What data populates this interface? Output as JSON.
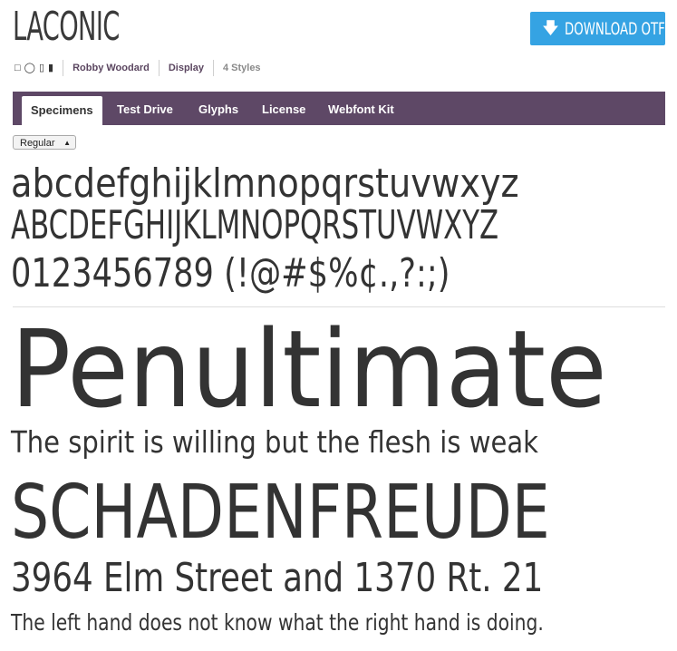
{
  "header": {
    "font_title": "LACONIC",
    "download_label": "DOWNLOAD OTF",
    "download_icon": "arrow-down-icon"
  },
  "meta": {
    "usage_icons": [
      "desktop-icon",
      "globe-icon",
      "tablet-icon",
      "phone-icon"
    ],
    "author": "Robby Woodard",
    "category": "Display",
    "styles_count": "4 Styles"
  },
  "tabs": [
    {
      "label": "Specimens",
      "active": true
    },
    {
      "label": "Test Drive",
      "active": false
    },
    {
      "label": "Glyphs",
      "active": false
    },
    {
      "label": "License",
      "active": false
    },
    {
      "label": "Webfont Kit",
      "active": false
    }
  ],
  "style_select": {
    "selected": "Regular"
  },
  "charset": {
    "lowercase": "abcdefghijklmnopqrstuvwxyz",
    "uppercase": "ABCDEFGHIJKLMNOPQRSTUVWXYZ",
    "digits_punct": "0123456789 (!@#$%¢.,?:;)"
  },
  "samples": {
    "s1": "Penultimate",
    "s2": "The spirit is willing but the flesh is weak",
    "s3": "SCHADENFREUDE",
    "s4": "3964 Elm Street and 1370 Rt. 21",
    "s5": "The left hand does not know what the right hand is doing."
  },
  "colors": {
    "accent_download": "#35a3e3",
    "tabbar_bg": "#5e4866",
    "meta_link": "#5b4660",
    "text": "#333333"
  }
}
